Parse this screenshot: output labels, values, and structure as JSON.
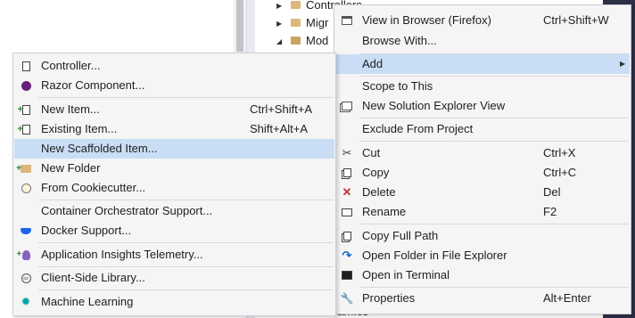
{
  "explorer": {
    "tree_items": [
      {
        "label": "Controllers",
        "expanded": false
      },
      {
        "label": "Migr",
        "expanded": false
      },
      {
        "label": "Mod",
        "expanded": true
      }
    ],
    "partial_file": "ram.cs"
  },
  "context_menu": {
    "items": [
      {
        "icon": "browser-icon",
        "label": "View in Browser (Firefox)",
        "shortcut": "Ctrl+Shift+W"
      },
      {
        "icon": "",
        "label": "Browse With...",
        "shortcut": ""
      },
      {
        "icon": "",
        "label": "Add",
        "shortcut": "",
        "submenu": true,
        "highlighted": true
      },
      {
        "icon": "",
        "label": "Scope to This",
        "shortcut": ""
      },
      {
        "icon": "new-solution-explorer-view-icon",
        "label": "New Solution Explorer View",
        "shortcut": ""
      },
      {
        "icon": "",
        "label": "Exclude From Project",
        "shortcut": ""
      },
      {
        "icon": "scissors-icon",
        "label": "Cut",
        "shortcut": "Ctrl+X"
      },
      {
        "icon": "copy-icon",
        "label": "Copy",
        "shortcut": "Ctrl+C"
      },
      {
        "icon": "delete-x-icon",
        "label": "Delete",
        "shortcut": "Del"
      },
      {
        "icon": "rename-icon",
        "label": "Rename",
        "shortcut": "F2"
      },
      {
        "icon": "copy-path-icon",
        "label": "Copy Full Path",
        "shortcut": ""
      },
      {
        "icon": "open-folder-arrow-icon",
        "label": "Open Folder in File Explorer",
        "shortcut": ""
      },
      {
        "icon": "terminal-icon",
        "label": "Open in Terminal",
        "shortcut": ""
      },
      {
        "icon": "wrench-icon",
        "label": "Properties",
        "shortcut": "Alt+Enter"
      }
    ]
  },
  "add_submenu": {
    "items": [
      {
        "icon": "controller-icon",
        "label": "Controller...",
        "shortcut": ""
      },
      {
        "icon": "razor-component-icon",
        "label": "Razor Component...",
        "shortcut": ""
      },
      {
        "icon": "new-item-icon",
        "label": "New Item...",
        "shortcut": "Ctrl+Shift+A"
      },
      {
        "icon": "existing-item-icon",
        "label": "Existing Item...",
        "shortcut": "Shift+Alt+A"
      },
      {
        "icon": "",
        "label": "New Scaffolded Item...",
        "shortcut": "",
        "highlighted": true
      },
      {
        "icon": "new-folder-icon",
        "label": "New Folder",
        "shortcut": ""
      },
      {
        "icon": "cookiecutter-icon",
        "label": "From Cookiecutter...",
        "shortcut": ""
      },
      {
        "icon": "",
        "label": "Container Orchestrator Support...",
        "shortcut": ""
      },
      {
        "icon": "docker-icon",
        "label": "Docker Support...",
        "shortcut": ""
      },
      {
        "icon": "application-insights-icon",
        "label": "Application Insights Telemetry...",
        "shortcut": ""
      },
      {
        "icon": "client-library-icon",
        "label": "Client-Side Library...",
        "shortcut": ""
      },
      {
        "icon": "machine-learning-icon",
        "label": "Machine Learning",
        "shortcut": ""
      }
    ]
  },
  "colors": {
    "menu_background": "#f5f5f5",
    "highlight": "#c9def5",
    "dark_band": "#2d3047"
  }
}
